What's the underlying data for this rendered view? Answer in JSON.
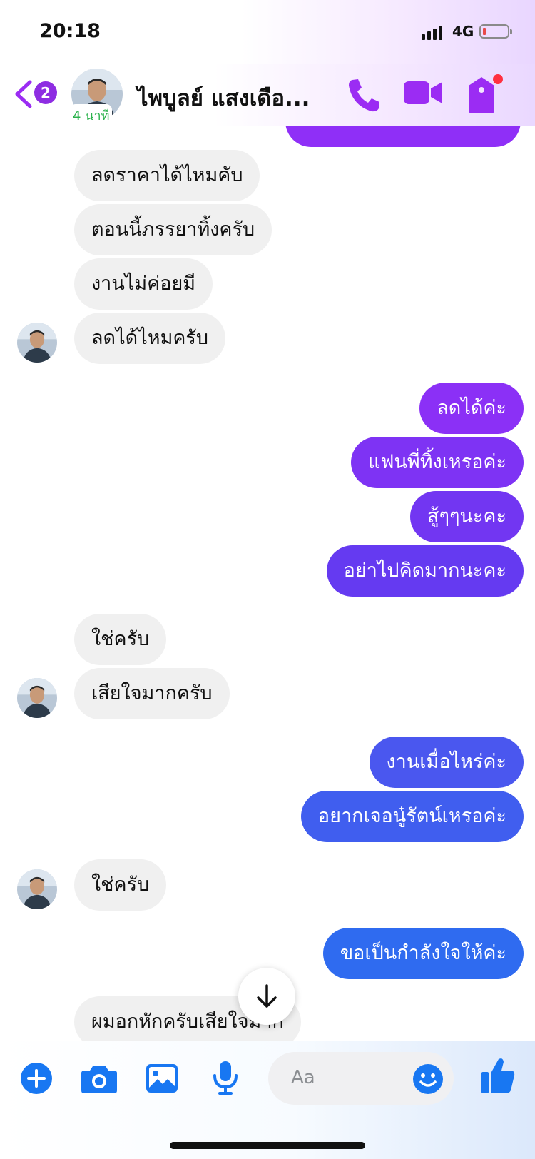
{
  "status_bar": {
    "time": "20:18",
    "network": "4G"
  },
  "header": {
    "back_badge": "2",
    "presence": "4 นาที",
    "contact_name": "ไพบูลย์ แสงเดือ...",
    "icons": [
      "back-chevron-icon",
      "phone-icon",
      "video-camera-icon",
      "shop-tag-icon"
    ],
    "accent_color": "#9b2cf3"
  },
  "messages": [
    {
      "side": "in",
      "text": "ลดราคาได้ไหมคับ"
    },
    {
      "side": "in",
      "text": "ตอนนี้ภรรยาทิ้งครับ"
    },
    {
      "side": "in",
      "text": "งานไม่ค่อยมี"
    },
    {
      "side": "in",
      "text": "ลดได้ไหมครับ"
    },
    {
      "side": "out",
      "text": "ลดได้ค่ะ"
    },
    {
      "side": "out",
      "text": "แฟนพี่ทิ้งเหรอค่ะ"
    },
    {
      "side": "out",
      "text": "สู้ๆๆนะคะ"
    },
    {
      "side": "out",
      "text": "อย่าไปคิดมากนะคะ"
    },
    {
      "side": "in",
      "text": "ใช่ครับ"
    },
    {
      "side": "in",
      "text": "เสียใจมากครับ"
    },
    {
      "side": "out",
      "text": "งานเมื่อไหร่ค่ะ"
    },
    {
      "side": "out",
      "text": "อยากเจอนู๋รัตน์เหรอค่ะ"
    },
    {
      "side": "in",
      "text": "ใช่ครับ"
    },
    {
      "side": "out",
      "text": "ขอเป็นกำลังใจให้ค่ะ"
    },
    {
      "side": "in",
      "text": "ผมอกหักครับเสียใจมาก"
    }
  ],
  "scroll_down_icon": "arrow-down-icon",
  "composer": {
    "placeholder": "Aa",
    "icons": [
      "plus-icon",
      "camera-icon",
      "image-icon",
      "microphone-icon",
      "emoji-icon",
      "thumbs-up-icon"
    ],
    "accent_color": "#1877f2"
  },
  "colors": {
    "outgoing_top": "#9b2ff6",
    "outgoing_bottom": "#2d6bf0",
    "incoming": "#f0f0f0"
  }
}
